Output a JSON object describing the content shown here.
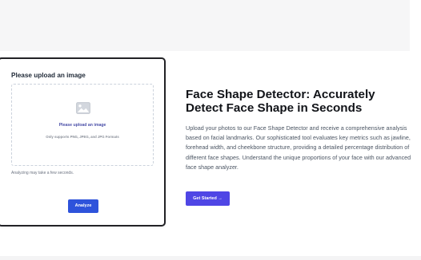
{
  "upload_panel": {
    "heading": "Please upload an image",
    "dropzone": {
      "icon": "image-icon",
      "title": "Please upload an image",
      "subtitle": "Only supports PNG, JPEG, and JPG Formats"
    },
    "note": "Analyzing may take a few seconds.",
    "analyze_label": "Analyze"
  },
  "hero": {
    "title": "Face Shape Detector: Accurately Detect Face Shape in Seconds",
    "description": "Upload your photos to our Face Shape Detector and receive a comprehensive analysis based on facial landmarks. Our sophisticated tool evaluates key metrics such as jawline, forehead width, and cheekbone structure, providing a detailed percentage distribution of different face shapes. Understand the unique proportions of your face with our advanced face shape analyzer.",
    "cta_label": "Get Started →"
  },
  "colors": {
    "analyze_button": "#2e53db",
    "cta_button": "#4f46e5",
    "dropzone_title": "#4a4fa8",
    "card_border": "#222226"
  }
}
